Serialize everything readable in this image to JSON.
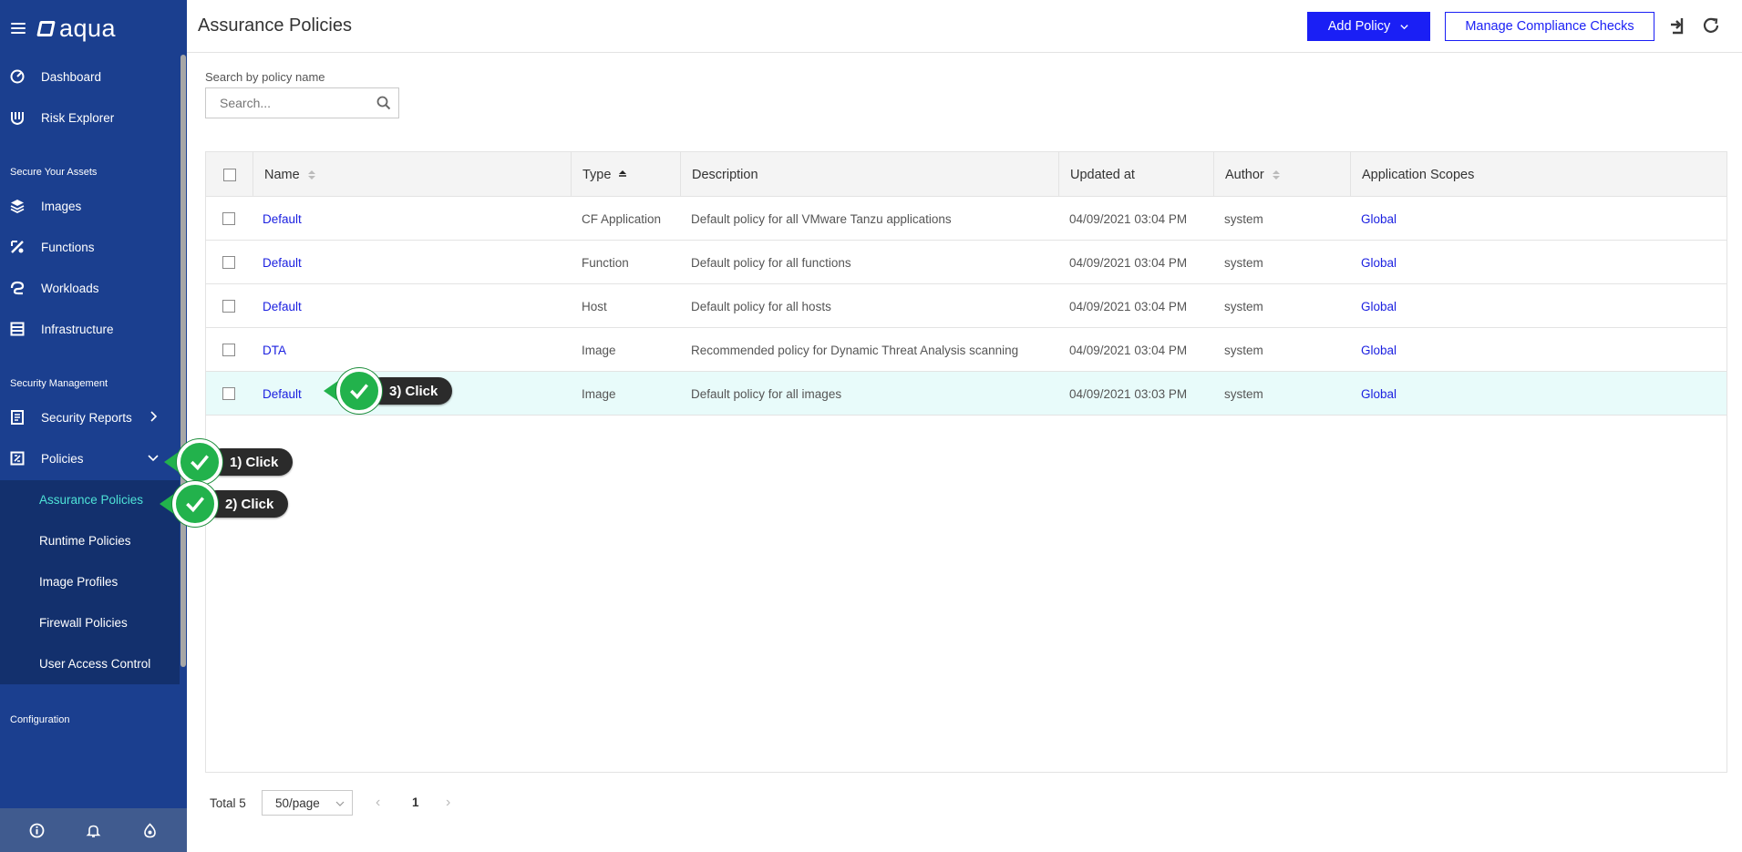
{
  "app": {
    "logo_text": "aqua"
  },
  "sidebar": {
    "top_items": [
      {
        "label": "Dashboard",
        "icon": "dashboard-icon"
      },
      {
        "label": "Risk Explorer",
        "icon": "risk-explorer-icon"
      }
    ],
    "section_secure": "Secure Your Assets",
    "secure_items": [
      {
        "label": "Images",
        "icon": "layers-icon"
      },
      {
        "label": "Functions",
        "icon": "function-icon"
      },
      {
        "label": "Workloads",
        "icon": "workloads-icon"
      },
      {
        "label": "Infrastructure",
        "icon": "infrastructure-icon"
      }
    ],
    "section_security": "Security Management",
    "security_items": [
      {
        "label": "Security Reports",
        "icon": "report-icon"
      },
      {
        "label": "Policies",
        "icon": "policies-icon"
      }
    ],
    "policy_subitems": [
      {
        "label": "Assurance Policies",
        "active": true
      },
      {
        "label": "Runtime Policies"
      },
      {
        "label": "Image Profiles"
      },
      {
        "label": "Firewall Policies"
      },
      {
        "label": "User Access Control"
      }
    ],
    "section_config": "Configuration",
    "footer_icons": [
      "info-icon",
      "bell-icon",
      "support-icon"
    ]
  },
  "header": {
    "title": "Assurance Policies",
    "add_policy_label": "Add Policy",
    "manage_label": "Manage Compliance Checks"
  },
  "search": {
    "label": "Search by policy name",
    "placeholder": "Search..."
  },
  "table": {
    "columns": [
      "Name",
      "Type",
      "Description",
      "Updated at",
      "Author",
      "Application Scopes"
    ],
    "rows": [
      {
        "name": "Default",
        "type": "CF Application",
        "description": "Default policy for all VMware Tanzu applications",
        "updated": "04/09/2021 03:04 PM",
        "author": "system",
        "scope": "Global"
      },
      {
        "name": "Default",
        "type": "Function",
        "description": "Default policy for all functions",
        "updated": "04/09/2021 03:04 PM",
        "author": "system",
        "scope": "Global"
      },
      {
        "name": "Default",
        "type": "Host",
        "description": "Default policy for all hosts",
        "updated": "04/09/2021 03:04 PM",
        "author": "system",
        "scope": "Global"
      },
      {
        "name": "DTA",
        "type": "Image",
        "description": "Recommended policy for Dynamic Threat Analysis scanning",
        "updated": "04/09/2021 03:04 PM",
        "author": "system",
        "scope": "Global"
      },
      {
        "name": "Default",
        "type": "Image",
        "description": "Default policy for all images",
        "updated": "04/09/2021 03:03 PM",
        "author": "system",
        "scope": "Global"
      }
    ]
  },
  "pagination": {
    "total": "Total 5",
    "page_size": "50/page",
    "current_page": "1"
  },
  "callouts": [
    {
      "label": "1) Click"
    },
    {
      "label": "2) Click"
    },
    {
      "label": "3) Click"
    }
  ],
  "colors": {
    "sidebar": "#1b3f8f",
    "accent": "#1a1ff5",
    "active_sub": "#4ee3d7",
    "callout_green": "#22b24c"
  }
}
